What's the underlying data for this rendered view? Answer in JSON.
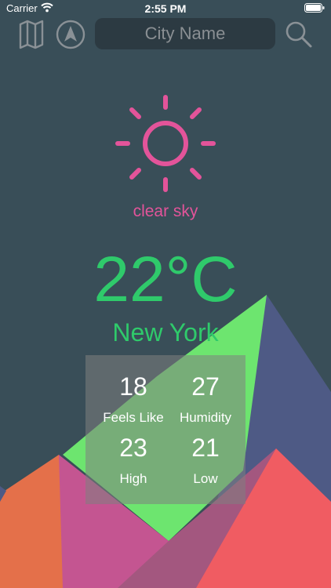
{
  "status_bar": {
    "carrier": "Carrier",
    "time": "2:55 PM"
  },
  "search": {
    "placeholder": "City Name"
  },
  "weather": {
    "condition": "clear sky",
    "temperature": "22°C",
    "city": "New York",
    "feels_like_value": "18",
    "feels_like_label": "Feels Like",
    "humidity_value": "27",
    "humidity_label": "Humidity",
    "high_value": "23",
    "high_label": "High",
    "low_value": "21",
    "low_label": "Low"
  },
  "colors": {
    "background": "#394e58",
    "sun": "#e3549a",
    "temperature": "#2fca6b",
    "icons": "#8a9196"
  },
  "icons": [
    "wifi-icon",
    "battery-icon",
    "map-icon",
    "navigation-arrow-icon",
    "search-icon",
    "sun-icon"
  ]
}
